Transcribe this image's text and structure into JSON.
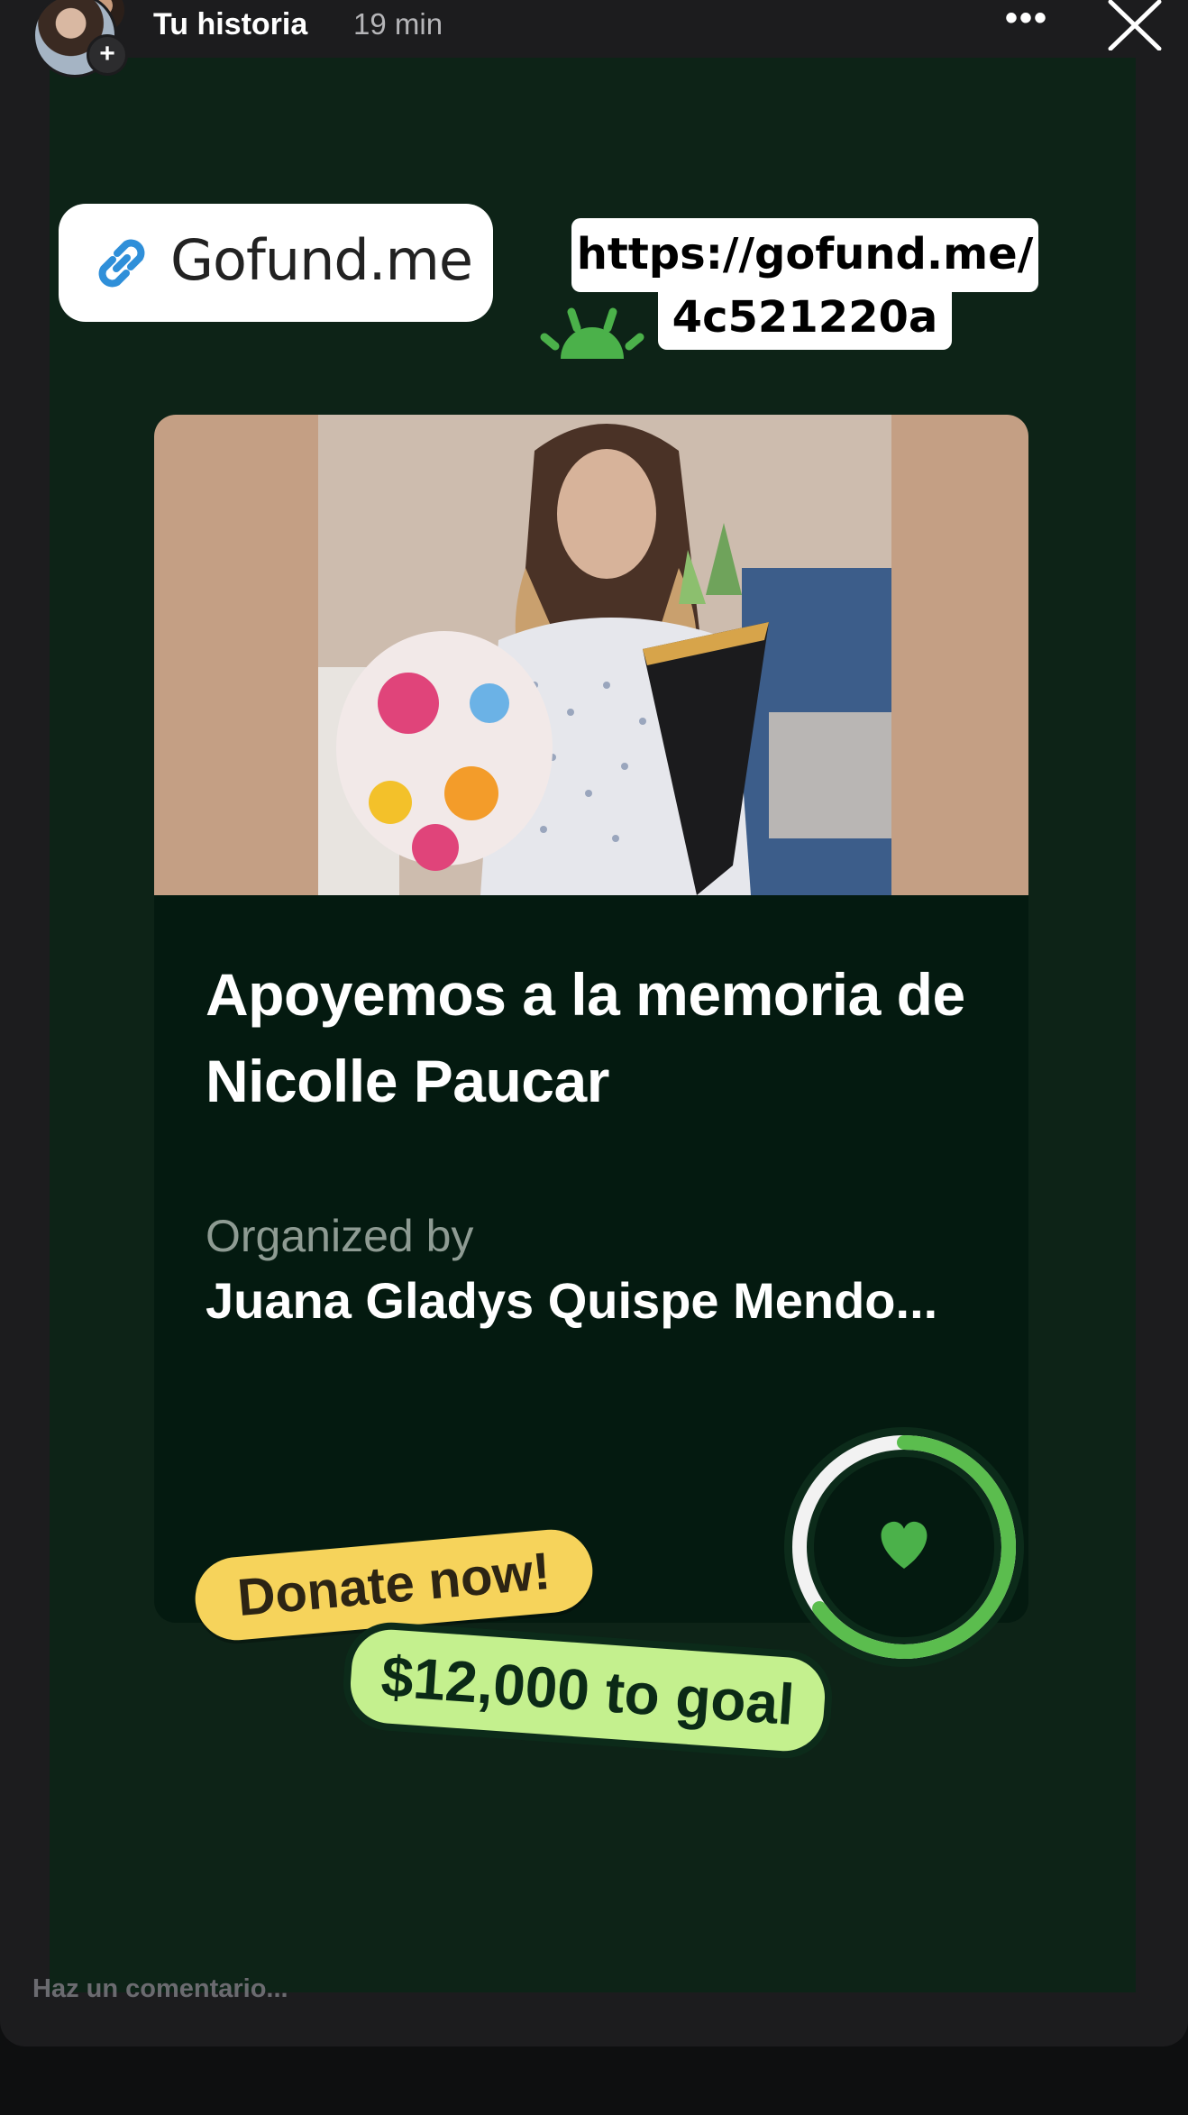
{
  "header": {
    "user": "Tu historia",
    "time": "19 min",
    "add_symbol": "+",
    "more_symbol": "•••"
  },
  "stickers": {
    "link_text": "Gofund.me",
    "url_line1": "https://gofund.me/",
    "url_line2": "4c521220a"
  },
  "card": {
    "title": "Apoyemos a la memoria de Nicolle Paucar",
    "organized_label": "Organized by",
    "organizer": "Juana Gladys Quispe Mendo...",
    "donate_label": "Donate now!",
    "goal_label": "$12,000 to goal",
    "progress_fraction": 0.65
  },
  "comment": {
    "placeholder": "Haz un comentario..."
  },
  "colors": {
    "canvas": "#0d2317",
    "card": "#041a10",
    "donate": "#f6d35b",
    "goal": "#c4f08e",
    "progress": "#5bbd4e"
  },
  "icons": [
    "link-icon",
    "heart-icon",
    "close-icon",
    "more-icon",
    "add-icon"
  ]
}
